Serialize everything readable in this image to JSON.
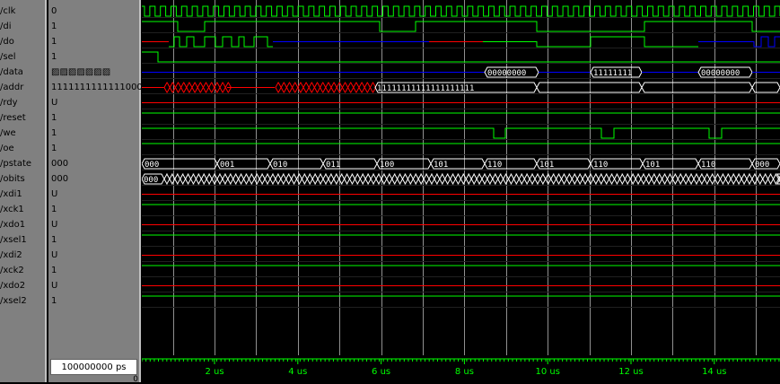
{
  "signals": [
    {
      "name": "/clk",
      "value": "0"
    },
    {
      "name": "/di",
      "value": "1"
    },
    {
      "name": "/do",
      "value": "1"
    },
    {
      "name": "/sel",
      "value": "1"
    },
    {
      "name": "/data",
      "value": "▨▨▨▨▨▨▨"
    },
    {
      "name": "/addr",
      "value": "1111111111111000"
    },
    {
      "name": "/rdy",
      "value": "U"
    },
    {
      "name": "/reset",
      "value": "1"
    },
    {
      "name": "/we",
      "value": "1"
    },
    {
      "name": "/oe",
      "value": "1"
    },
    {
      "name": "/pstate",
      "value": "000"
    },
    {
      "name": "/obits",
      "value": "000"
    },
    {
      "name": "/xdi1",
      "value": "U"
    },
    {
      "name": "/xck1",
      "value": "1"
    },
    {
      "name": "/xdo1",
      "value": "U"
    },
    {
      "name": "/xsel1",
      "value": "1"
    },
    {
      "name": "/xdi2",
      "value": "U"
    },
    {
      "name": "/xck2",
      "value": "1"
    },
    {
      "name": "/xdo2",
      "value": "U"
    },
    {
      "name": "/xsel2",
      "value": "1"
    }
  ],
  "bus_labels": {
    "data": [
      "00000000",
      "11111111",
      "00000000"
    ],
    "addr": "11111111111111111111",
    "pstate": [
      "000",
      "001",
      "010",
      "011",
      "100",
      "101",
      "110",
      "101",
      "110",
      "101",
      "110",
      "000"
    ],
    "obits": "000"
  },
  "cursor": {
    "time": "100000000 ps",
    "delta": "0"
  },
  "timeline": {
    "ticks": [
      "2 us",
      "4 us",
      "6 us",
      "8 us",
      "10 us",
      "12 us",
      "14 us"
    ]
  },
  "colors": {
    "green": "#00ff00",
    "red": "#ff0000",
    "blue": "#0000ff",
    "white": "#ffffff",
    "grid": "#c0c0c0",
    "panel": "#808080"
  }
}
